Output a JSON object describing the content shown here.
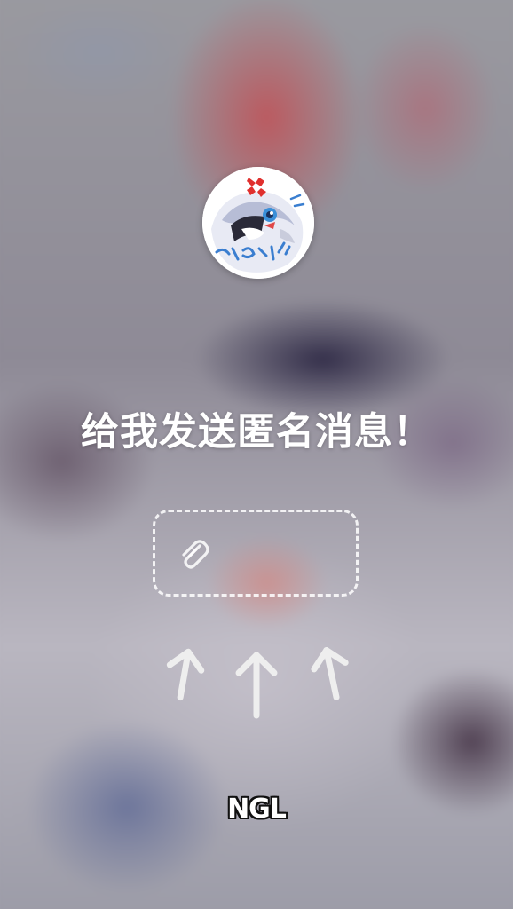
{
  "headline": "给我发送匿名消息！",
  "brand": "NGL",
  "icons": {
    "attachment": "paperclip-icon",
    "arrow": "arrow-up-icon"
  },
  "colors": {
    "text": "#ffffff",
    "dash_border": "#ffffff"
  }
}
